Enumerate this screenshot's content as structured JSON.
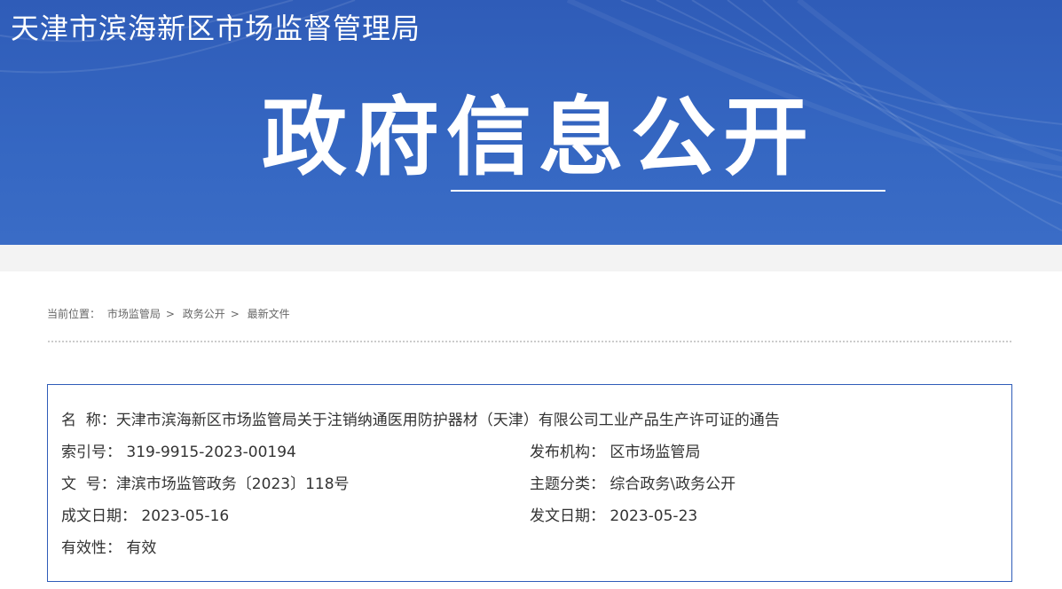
{
  "header": {
    "site_title": "天津市滨海新区市场监督管理局",
    "banner_title": "政府信息公开"
  },
  "breadcrumb": {
    "prefix": "当前位置：",
    "items": [
      "市场监管局",
      "政务公开",
      "最新文件"
    ],
    "separator": ">"
  },
  "info": {
    "name_label": "名  称：",
    "name_value": "天津市滨海新区市场监管局关于注销纳通医用防护器材（天津）有限公司工业产品生产许可证的通告",
    "index_label": "索引号：",
    "index_value": "319-9915-2023-00194",
    "publisher_label": "发布机构：",
    "publisher_value": "区市场监管局",
    "doc_no_label": "文  号：",
    "doc_no_value": "津滨市场监管政务〔2023〕118号",
    "topic_label": "主题分类：",
    "topic_value": "综合政务\\政务公开",
    "written_date_label": "成文日期：",
    "written_date_value": "2023-05-16",
    "issue_date_label": "发文日期：",
    "issue_date_value": "2023-05-23",
    "validity_label": "有效性：",
    "validity_value": "有效"
  },
  "colors": {
    "banner": "#2f5cb8",
    "border": "#2f5cb8"
  }
}
